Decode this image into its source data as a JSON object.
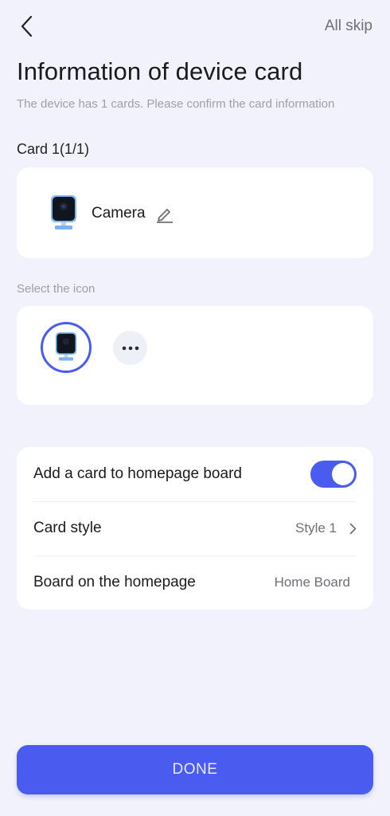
{
  "header": {
    "skip_label": "All skip"
  },
  "title": "Information of device card",
  "subtitle": "The device has 1 cards. Please confirm the card information",
  "card_count_label": "Card 1(1/1)",
  "device_card": {
    "name": "Camera",
    "icon": "camera-icon"
  },
  "icon_section": {
    "label": "Select the icon",
    "selected_icon": "camera-icon",
    "more_icon": "more-icon"
  },
  "settings": {
    "add_card": {
      "label": "Add a card to homepage board",
      "enabled": true
    },
    "card_style": {
      "label": "Card style",
      "value": "Style 1"
    },
    "board": {
      "label": "Board on the homepage",
      "value": "Home Board"
    }
  },
  "done_label": "DONE",
  "colors": {
    "accent": "#4a5cf0",
    "background": "#f1f2fb",
    "panel": "#ffffff",
    "secondary_text": "#9fa0a6"
  }
}
